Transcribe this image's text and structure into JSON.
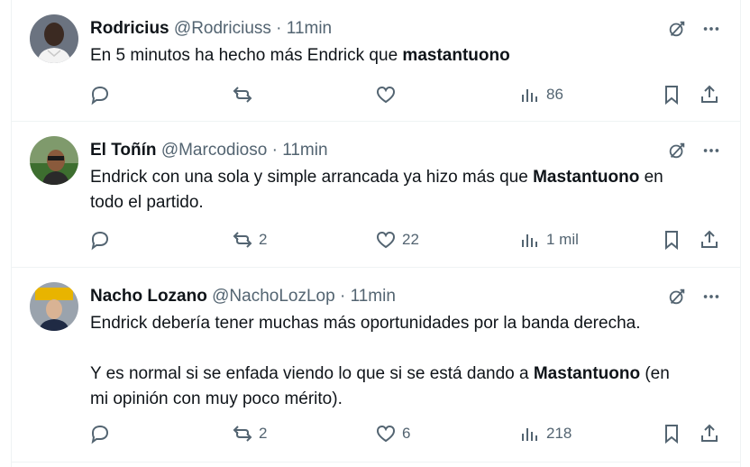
{
  "tweets": [
    {
      "name": "Rodricius",
      "handle": "@Rodriciuss",
      "time": "11min",
      "text_parts": [
        "En 5 minutos ha hecho más Endrick que ",
        "mastantuono",
        ""
      ],
      "stats": {
        "replies": "",
        "retweets": "",
        "likes": "",
        "views": "86"
      }
    },
    {
      "name": "El Toñín",
      "handle": "@Marcodioso",
      "time": "11min",
      "text_parts": [
        "Endrick con una sola y simple arrancada ya hizo más que ",
        "Mastantuono",
        " en\ntodo el partido."
      ],
      "stats": {
        "replies": "",
        "retweets": "2",
        "likes": "22",
        "views": "1 mil"
      }
    },
    {
      "name": "Nacho Lozano",
      "handle": "@NachoLozLop",
      "time": "11min",
      "text_parts": [
        "Endrick debería tener muchas más oportunidades por la banda derecha.\n\nY es normal si se enfada viendo lo que si se está dando a ",
        "Mastantuono",
        " (en\nmi opinión con muy poco mérito)."
      ],
      "stats": {
        "replies": "",
        "retweets": "2",
        "likes": "6",
        "views": "218"
      }
    }
  ],
  "separator": " · ",
  "icons": {
    "grok": "grok-icon",
    "more": "more-dots-icon",
    "reply": "reply-icon",
    "retweet": "retweet-icon",
    "like": "heart-icon",
    "views": "views-chart-icon",
    "bookmark": "bookmark-icon",
    "share": "share-icon"
  },
  "colors": {
    "text": "#0f1419",
    "muted": "#536471",
    "border": "#eff3f4"
  }
}
